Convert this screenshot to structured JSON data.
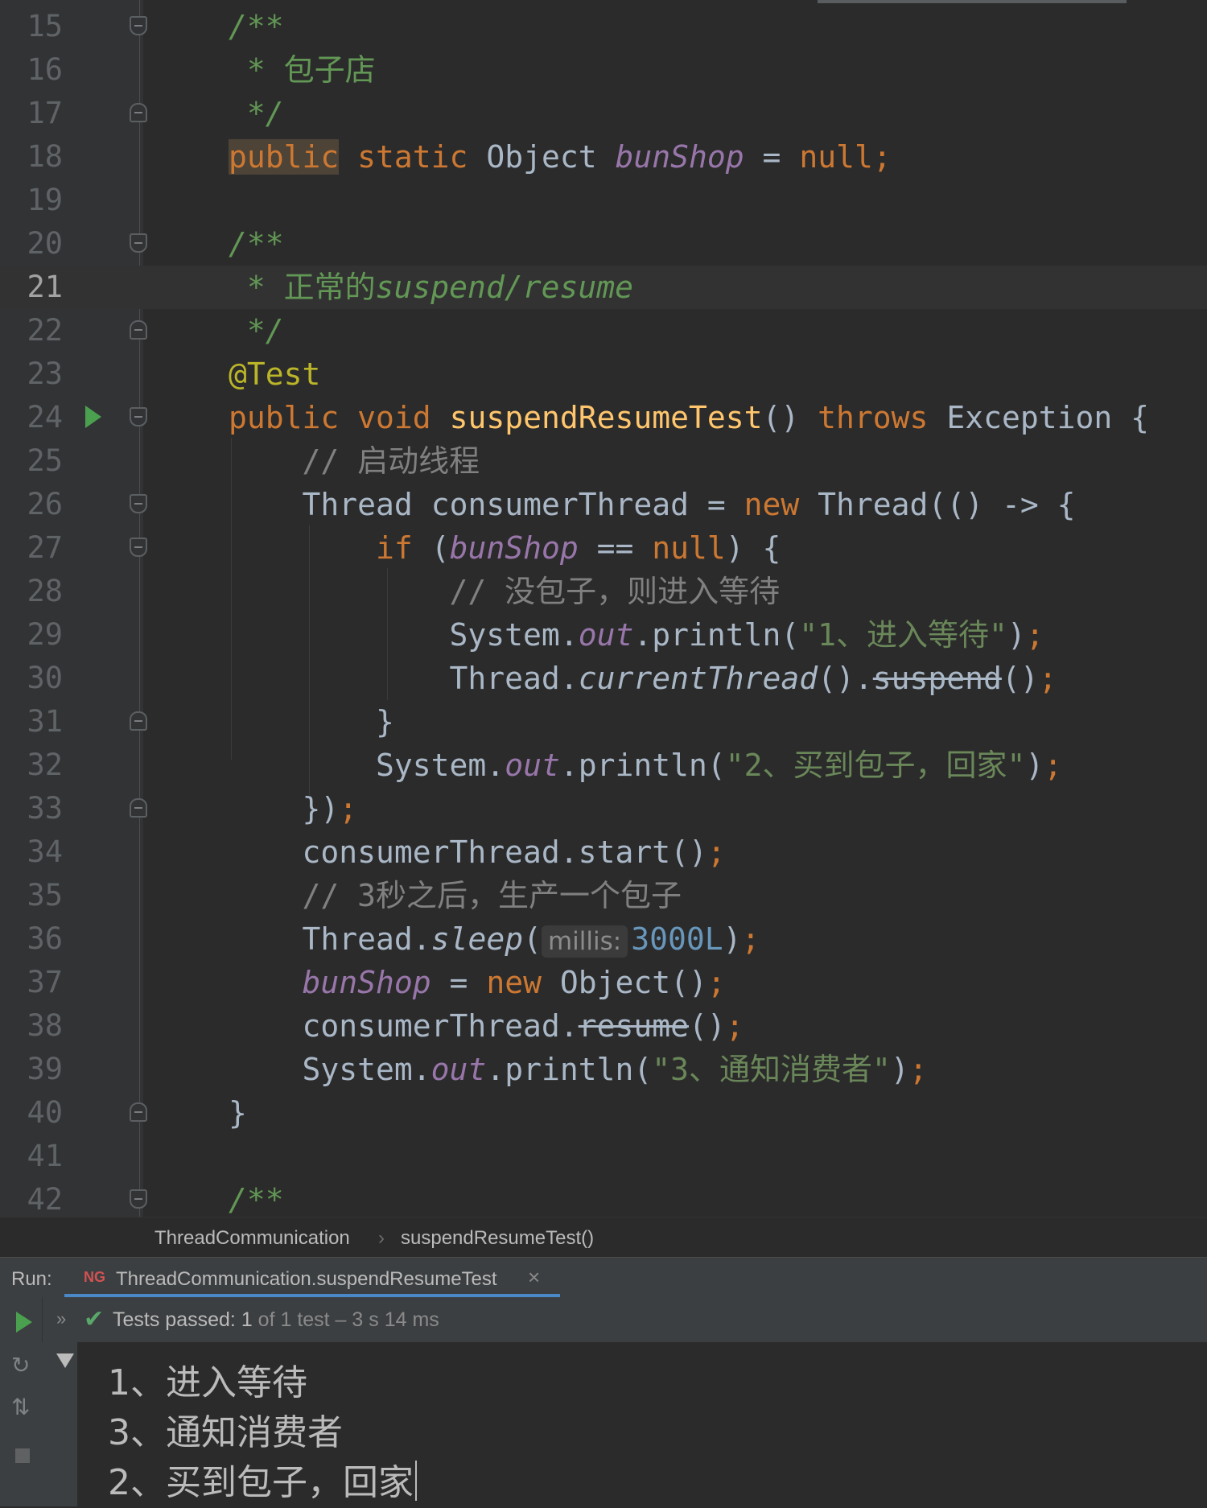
{
  "editor": {
    "current_line": 21,
    "lines": [
      {
        "n": "15"
      },
      {
        "n": "16"
      },
      {
        "n": "17"
      },
      {
        "n": "18"
      },
      {
        "n": "19"
      },
      {
        "n": "20"
      },
      {
        "n": "21"
      },
      {
        "n": "22"
      },
      {
        "n": "23"
      },
      {
        "n": "24"
      },
      {
        "n": "25"
      },
      {
        "n": "26"
      },
      {
        "n": "27"
      },
      {
        "n": "28"
      },
      {
        "n": "29"
      },
      {
        "n": "30"
      },
      {
        "n": "31"
      },
      {
        "n": "32"
      },
      {
        "n": "33"
      },
      {
        "n": "34"
      },
      {
        "n": "35"
      },
      {
        "n": "36"
      },
      {
        "n": "37"
      },
      {
        "n": "38"
      },
      {
        "n": "39"
      },
      {
        "n": "40"
      },
      {
        "n": "41"
      },
      {
        "n": "42"
      }
    ],
    "t": {
      "doc_open": "/**",
      "doc_star": "* ",
      "doc_close": "*/",
      "bun_shop_doc": "包子店",
      "normal_doc": "正常的",
      "normal_doc_code": "suspend/resume",
      "public": "public",
      "static": "static",
      "object": "Object",
      "bun_shop": "bunShop",
      "eq": " = ",
      "null_semi": "null;",
      "annotation": "@Test",
      "void": "void",
      "method": "suspendResumeTest",
      "parens": "()",
      "throws": "throws",
      "exception": "Exception",
      "lbrace": "{",
      "comment_start_thread": "// 启动线程",
      "thread": "Thread",
      "consumer_thread": "consumerThread",
      "new": "new",
      "lambda_open": "(() -> {",
      "if": "if",
      "paren_open": "(",
      "eqeq_null": " == ",
      "null": "null",
      "if_close": ") {",
      "comment_wait": "// 没包子，则进入等待",
      "system": "System.",
      "out": "out",
      "println": ".println(",
      "str1": "\"1、进入等待\"",
      "close_paren": ")",
      "semi": ";",
      "dot": ".",
      "current_thread": "currentThread",
      "suspend": "suspend",
      "rbrace": "}",
      "str2": "\"2、买到包子，回家\"",
      "lambda_close": "})",
      "start_call": "consumerThread.start()",
      "comment_produce": "// 3秒之后，生产一个包子",
      "sleep": "sleep",
      "hint_millis": "millis:",
      "sleep_value": "3000L",
      "new_object": "Object()",
      "resume": "resume",
      "str3": "\"3、通知消费者\""
    }
  },
  "breadcrumb": {
    "class_name": "ThreadCommunication",
    "separator": "›",
    "method_name": "suspendResumeTest()"
  },
  "run_panel": {
    "label": "Run:",
    "tab_icon": "NG",
    "tab_title": "ThreadCommunication.suspendResumeTest",
    "tab_close": "×",
    "status_prefix": "Tests passed:",
    "status_count": "1",
    "status_rest": "of 1 test – 3 s 14 ms",
    "output": [
      "1、进入等待",
      "3、通知消费者",
      "2、买到包子，回家"
    ]
  },
  "colors": {
    "background": "#2b2b2b",
    "keyword": "#cc7832",
    "string": "#6a8759",
    "method": "#ffc66d",
    "field": "#9876aa",
    "number": "#6897bb",
    "success": "#59a869",
    "accent": "#4a88c7"
  },
  "icons": [
    "fold-icon",
    "run-gutter-icon",
    "testng-icon",
    "close-icon",
    "play-icon",
    "rerun-failed-icon",
    "toggle-icon",
    "stop-icon",
    "chevron-icon",
    "check-icon",
    "collapse-triangle-icon"
  ]
}
